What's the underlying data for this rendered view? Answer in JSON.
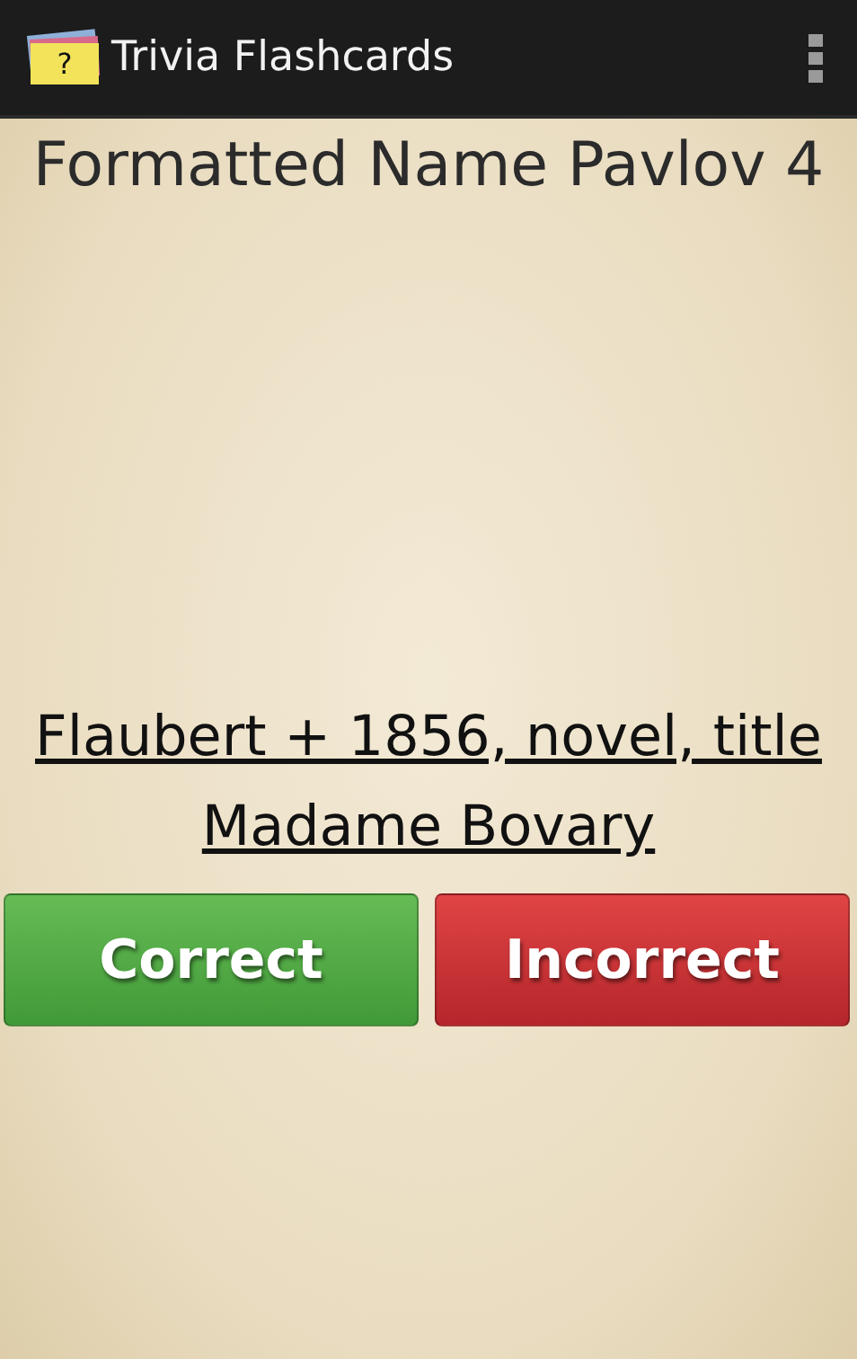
{
  "action_bar": {
    "icon_mark": "?",
    "title": "Trivia Flashcards"
  },
  "card": {
    "title": "Formatted Name Pavlov 4",
    "question": "Flaubert + 1856, novel, title Madame Bovary"
  },
  "buttons": [
    {
      "label": "Correct",
      "kind": "correct"
    },
    {
      "label": "Incorrect",
      "kind": "incorrect"
    }
  ]
}
